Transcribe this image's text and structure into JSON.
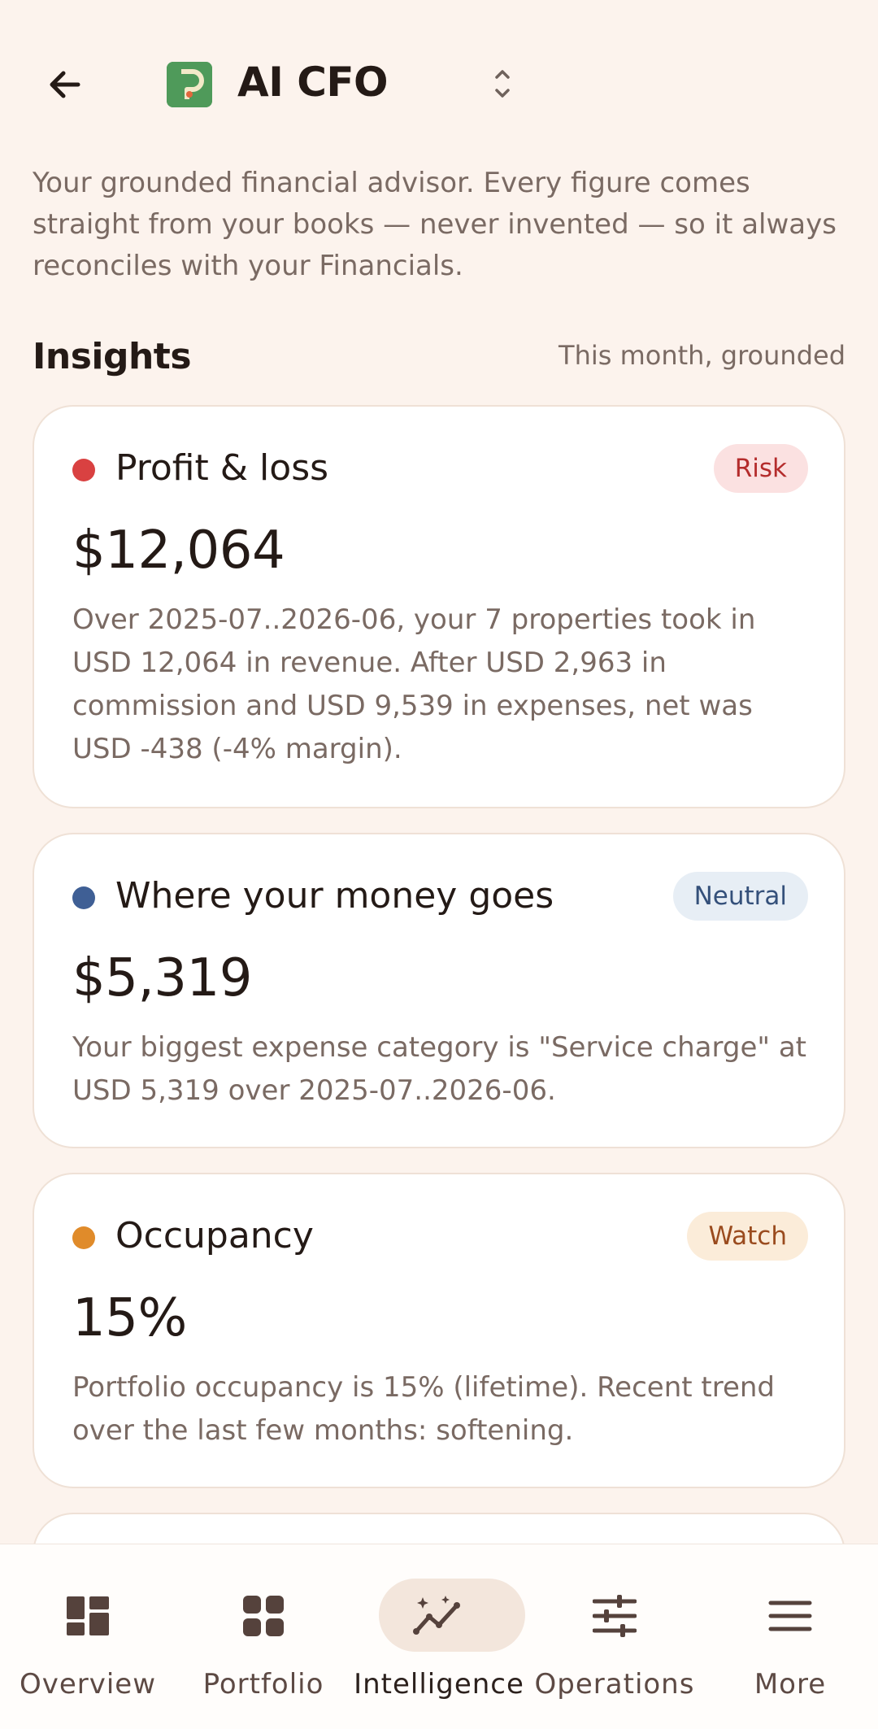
{
  "header": {
    "title": "AI CFO",
    "logo_letter": "P",
    "intro": "Your grounded financial advisor. Every figure comes straight from your books — never invented — so it always reconciles with your Financials."
  },
  "insights": {
    "title": "Insights",
    "subtitle": "This month, grounded",
    "cards": [
      {
        "title": "Profit & loss",
        "badge": "Risk",
        "value": "$12,064",
        "text": "Over 2025-07..2026-06, your 7 properties took in USD 12,064 in revenue. After USD 2,963 in commission and USD 9,539 in expenses, net was USD -438 (-4% margin).",
        "dot_color": "#d94141",
        "badge_bg": "#fbe1e1",
        "badge_color": "#b42c2c"
      },
      {
        "title": "Where your money goes",
        "badge": "Neutral",
        "value": "$5,319",
        "text": "Your biggest expense category is \"Service charge\" at USD 5,319 over 2025-07..2026-06.",
        "dot_color": "#3f5f95",
        "badge_bg": "#e7eef5",
        "badge_color": "#34507a"
      },
      {
        "title": "Occupancy",
        "badge": "Watch",
        "value": "15%",
        "text": "Portfolio occupancy is 15% (lifetime). Recent trend over the last few months: softening.",
        "dot_color": "#e08b2a",
        "badge_bg": "#fbecd9",
        "badge_color": "#9a4b1e"
      }
    ]
  },
  "nav": {
    "items": [
      {
        "label": "Overview",
        "icon": "dashboard-icon"
      },
      {
        "label": "Portfolio",
        "icon": "grid-icon"
      },
      {
        "label": "Intelligence",
        "icon": "sparkle-trend-icon",
        "active": true
      },
      {
        "label": "Operations",
        "icon": "sliders-icon"
      },
      {
        "label": "More",
        "icon": "menu-icon"
      }
    ]
  }
}
